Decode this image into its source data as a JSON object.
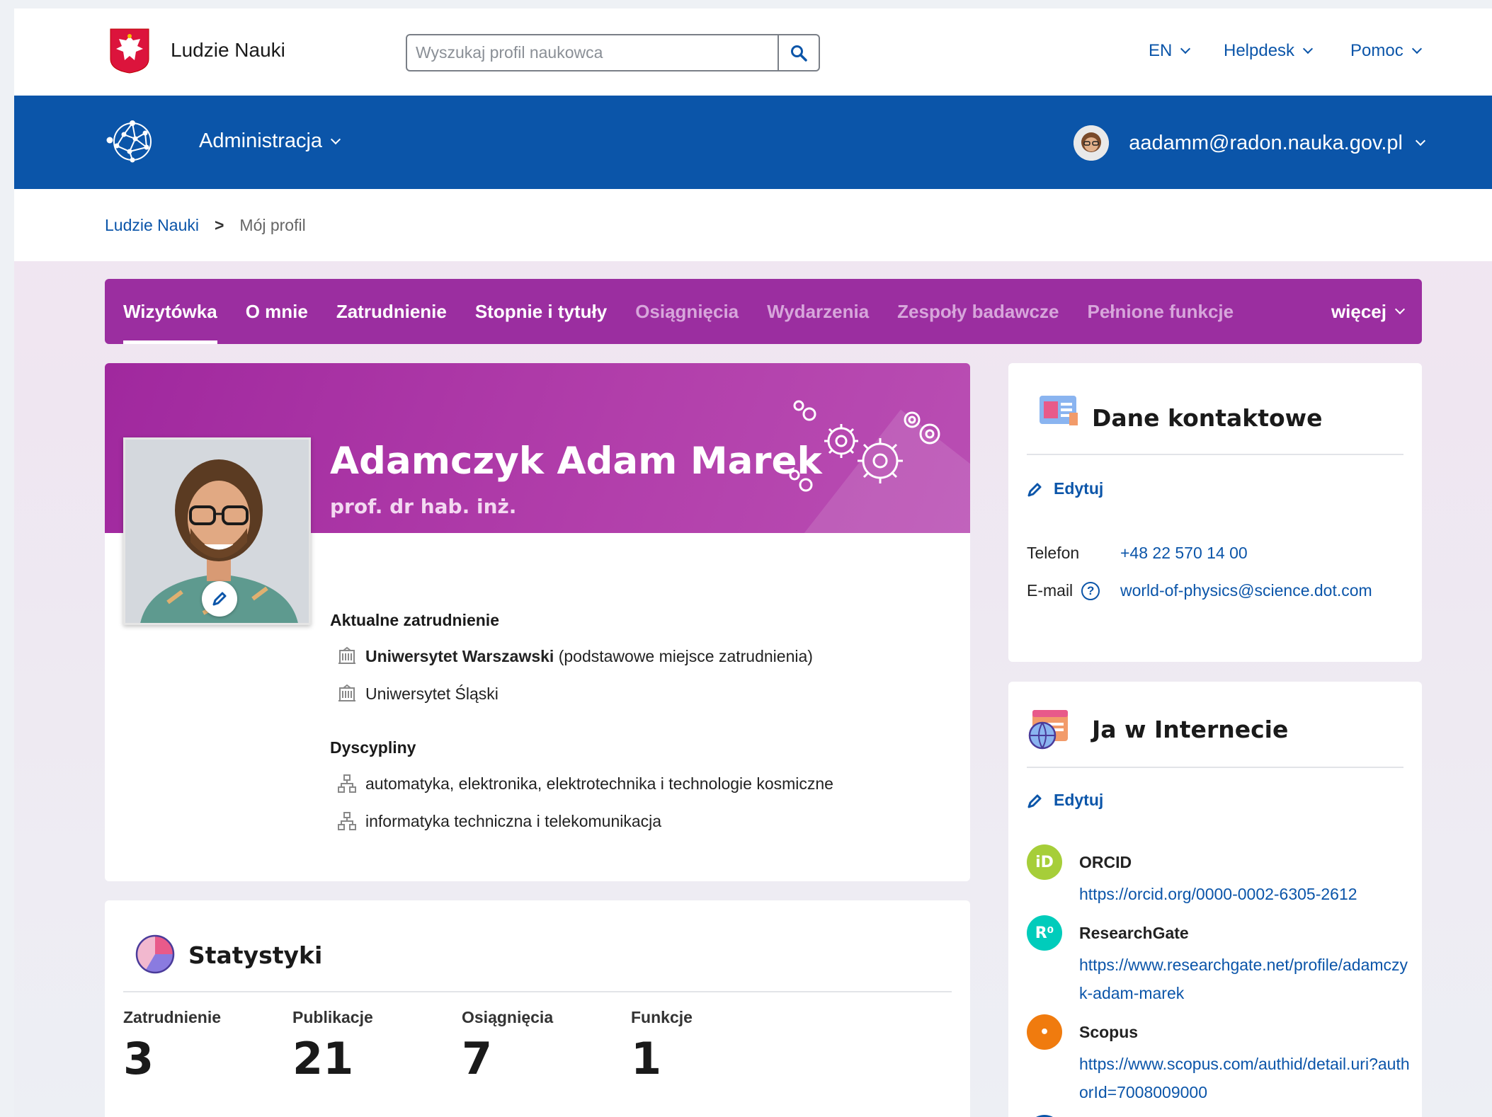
{
  "header": {
    "brand": "Ludzie Nauki",
    "search_placeholder": "Wyszukaj profil naukowca",
    "nav": [
      {
        "label": "EN"
      },
      {
        "label": "Helpdesk"
      },
      {
        "label": "Pomoc"
      }
    ]
  },
  "bluebar": {
    "admin_label": "Administracja",
    "user_email": "aadamm@radon.nauka.gov.pl"
  },
  "breadcrumb": {
    "home": "Ludzie Nauki",
    "separator": ">",
    "current": "Mój profil"
  },
  "tabs": {
    "items": [
      {
        "label": "Wizytówka",
        "active": true
      },
      {
        "label": "O mnie"
      },
      {
        "label": "Zatrudnienie"
      },
      {
        "label": "Stopnie i tytuły"
      },
      {
        "label": "Osiągnięcia",
        "muted": true
      },
      {
        "label": "Wydarzenia",
        "muted": true
      },
      {
        "label": "Zespoły badawcze",
        "muted": true
      },
      {
        "label": "Pełnione funkcje",
        "muted": true
      }
    ],
    "more": "więcej"
  },
  "profile": {
    "name": "Adamczyk Adam Marek",
    "title": "prof. dr hab. inż.",
    "employment_heading": "Aktualne zatrudnienie",
    "employment": [
      {
        "name": "Uniwersytet Warszawski",
        "note": "(podstawowe miejsce zatrudnienia)"
      },
      {
        "name": "Uniwersytet Śląski",
        "note": ""
      }
    ],
    "disciplines_heading": "Dyscypliny",
    "disciplines": [
      "automatyka, elektronika, elektrotechnika i technologie kosmiczne",
      "informatyka techniczna i telekomunikacja"
    ]
  },
  "stats": {
    "title": "Statystyki",
    "items": [
      {
        "label": "Zatrudnienie",
        "value": "3"
      },
      {
        "label": "Publikacje",
        "value": "21"
      },
      {
        "label": "Osiągnięcia",
        "value": "7"
      },
      {
        "label": "Funkcje",
        "value": "1"
      }
    ]
  },
  "contact": {
    "title": "Dane kontaktowe",
    "edit_label": "Edytuj",
    "phone_label": "Telefon",
    "phone": "+48 22 570 14 00",
    "email_label": "E-mail",
    "help_glyph": "?",
    "email": "world-of-physics@science.dot.com"
  },
  "internet": {
    "title": "Ja w Internecie",
    "edit_label": "Edytuj",
    "profiles": [
      {
        "name": "ORCID",
        "glyph": "iD",
        "url": "https://orcid.org/0000-0002-6305-2612",
        "color": "#a6ce39"
      },
      {
        "name": "ResearchGate",
        "glyph": "R⁰",
        "url": "https://www.researchgate.net/profile/adamczyk-adam-marek",
        "color": "#00ccbb"
      },
      {
        "name": "Scopus",
        "glyph": "•",
        "url": "https://www.scopus.com/authid/detail.uri?authorId=7008009000",
        "color": "#f07b0e"
      }
    ]
  },
  "colors": {
    "primary_blue": "#0b55a9",
    "tab_purple": "#9b2ea0",
    "banner_purple": "#a0289e"
  }
}
